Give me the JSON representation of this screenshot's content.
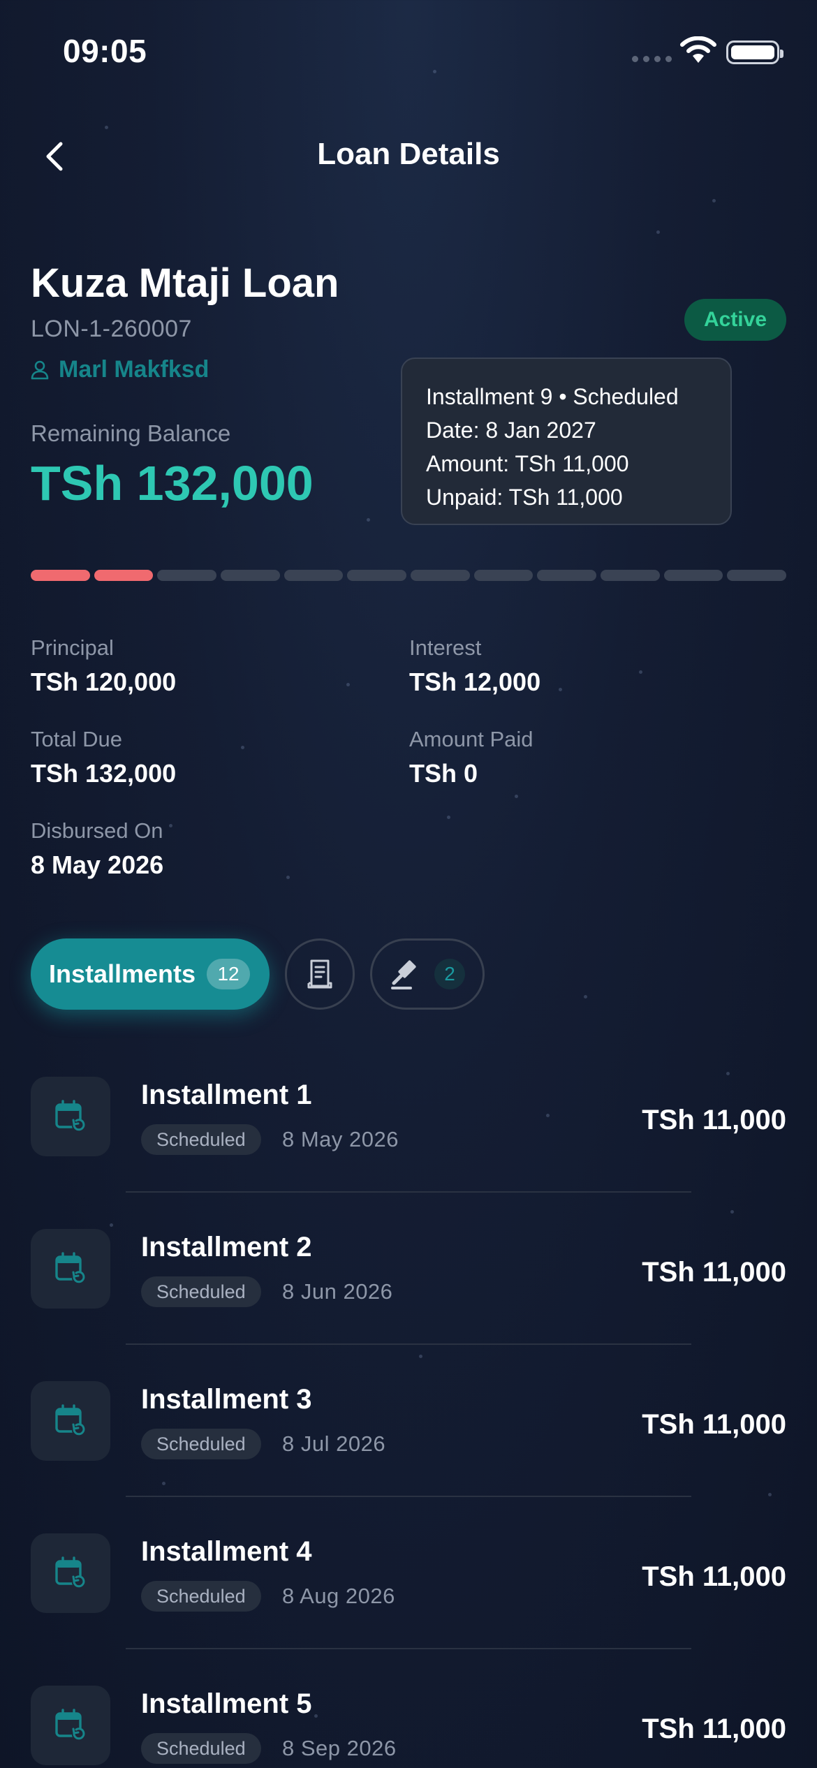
{
  "status_bar": {
    "time": "09:05"
  },
  "nav": {
    "title": "Loan Details"
  },
  "loan": {
    "name": "Kuza Mtaji Loan",
    "id": "LON-1-260007",
    "borrower": "Marl Makfksd",
    "status": "Active",
    "remaining_label": "Remaining Balance",
    "remaining_value": "TSh 132,000",
    "installments_total": 12,
    "installments_paid_segments": 2
  },
  "tooltip": {
    "line1": "Installment 9 • Scheduled",
    "line2": "Date: 8 Jan 2027",
    "line3": "Amount: TSh 11,000",
    "line4": "Unpaid: TSh 11,000"
  },
  "details": {
    "principal_label": "Principal",
    "principal_value": "TSh 120,000",
    "interest_label": "Interest",
    "interest_value": "TSh 12,000",
    "total_label": "Total Due",
    "total_value": "TSh 132,000",
    "paid_label": "Amount Paid",
    "paid_value": "TSh 0",
    "disbursed_label": "Disbursed On",
    "disbursed_value": "8 May 2026"
  },
  "tabs": {
    "installments_label": "Installments",
    "installments_count": "12",
    "penalties_count": "2"
  },
  "installments": [
    {
      "title": "Installment 1",
      "status": "Scheduled",
      "date": "8 May 2026",
      "amount": "TSh 11,000"
    },
    {
      "title": "Installment 2",
      "status": "Scheduled",
      "date": "8 Jun 2026",
      "amount": "TSh 11,000"
    },
    {
      "title": "Installment 3",
      "status": "Scheduled",
      "date": "8 Jul 2026",
      "amount": "TSh 11,000"
    },
    {
      "title": "Installment 4",
      "status": "Scheduled",
      "date": "8 Aug 2026",
      "amount": "TSh 11,000"
    },
    {
      "title": "Installment 5",
      "status": "Scheduled",
      "date": "8 Sep 2026",
      "amount": "TSh 11,000"
    }
  ],
  "colors": {
    "accent": "#168c93",
    "balance": "#2ec8b3",
    "paid_segment": "#f06a6f",
    "active_badge": "#34d39a"
  }
}
